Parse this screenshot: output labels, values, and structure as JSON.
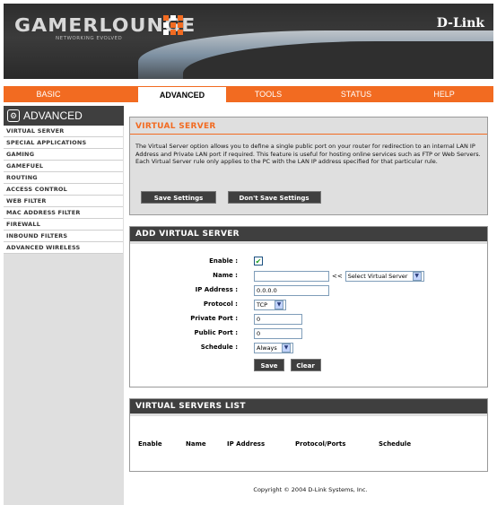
{
  "brand": {
    "logo": "GAMERLOUNGE",
    "logo_sub": "NETWORKING EVOLVED",
    "company": "D-Link",
    "grid_colors": [
      "#f26b21",
      "#ffffff",
      "#f26b21",
      "#ffffff",
      "#f26b21",
      "#f26b21",
      "#ffffff",
      "#f26b21",
      "#f26b21"
    ]
  },
  "nav": {
    "tabs": [
      {
        "label": "BASIC",
        "active": false
      },
      {
        "label": "ADVANCED",
        "active": true
      },
      {
        "label": "TOOLS",
        "active": false
      },
      {
        "label": "STATUS",
        "active": false
      },
      {
        "label": "HELP",
        "active": false
      }
    ]
  },
  "sidebar": {
    "title": "ADVANCED",
    "icon": "gear-icon",
    "items": [
      "VIRTUAL SERVER",
      "SPECIAL APPLICATIONS",
      "GAMING",
      "GAMEFUEL",
      "ROUTING",
      "ACCESS CONTROL",
      "WEB FILTER",
      "MAC ADDRESS FILTER",
      "FIREWALL",
      "INBOUND FILTERS",
      "ADVANCED WIRELESS"
    ]
  },
  "virtual_server": {
    "title": "VIRTUAL SERVER",
    "description": "The Virtual Server option allows you to define a single public port on your router for redirection to an internal LAN IP Address and Private LAN port if required. This feature is useful for hosting online services such as FTP or Web Servers. Each Virtual Server rule only applies to the PC with the LAN IP address specified for that particular rule.",
    "save_label": "Save Settings",
    "dont_save_label": "Don't Save Settings"
  },
  "add_server": {
    "title": "ADD VIRTUAL SERVER",
    "enable_label": "Enable :",
    "enable_checked": true,
    "name_label": "Name :",
    "name_value": "",
    "prefill_arrow": "<<",
    "prefill_select": "Select Virtual Server",
    "ip_label": "IP Address :",
    "ip_value": "0.0.0.0",
    "protocol_label": "Protocol :",
    "protocol_value": "TCP",
    "private_port_label": "Private Port :",
    "private_port_value": "0",
    "public_port_label": "Public Port :",
    "public_port_value": "0",
    "schedule_label": "Schedule :",
    "schedule_value": "Always",
    "save_label": "Save",
    "clear_label": "Clear"
  },
  "servers_list": {
    "title": "VIRTUAL SERVERS LIST",
    "columns": [
      "Enable",
      "Name",
      "IP Address",
      "Protocol/Ports",
      "Schedule"
    ]
  },
  "footer": {
    "copyright": "Copyright © 2004 D-Link Systems, Inc."
  },
  "colors": {
    "accent": "#f26b21",
    "dark": "#3f3f3f",
    "panel": "#dfdfdf"
  }
}
